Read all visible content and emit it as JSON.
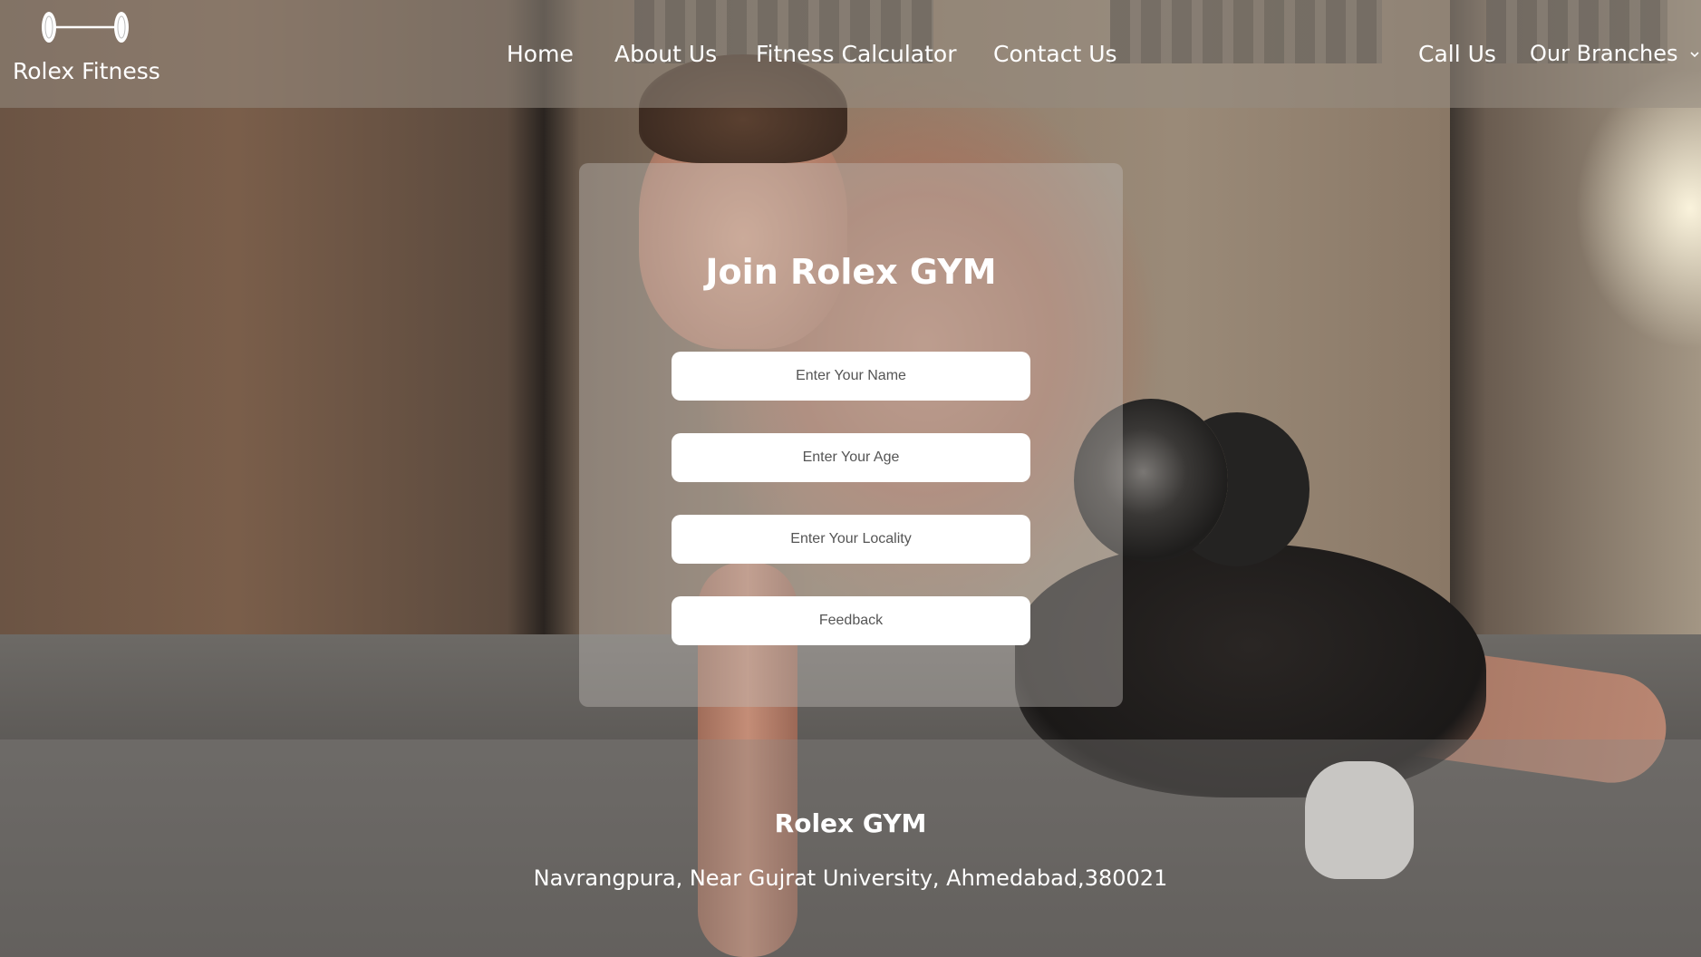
{
  "header": {
    "brand": "Rolex Fitness",
    "logo_icon": "dumbbell-icon",
    "nav": {
      "home": "Home",
      "about": "About Us",
      "calculator": "Fitness Calculator",
      "contact": "Contact Us",
      "call": "Call Us",
      "branches": "Our Branches"
    },
    "branches_icon": "chevron-down-icon"
  },
  "form": {
    "title": "Join Rolex GYM",
    "name_placeholder": "Enter Your Name",
    "age_placeholder": "Enter Your Age",
    "locality_placeholder": "Enter Your Locality",
    "feedback_placeholder": "Feedback"
  },
  "footer": {
    "title": "Rolex GYM",
    "address": "Navrangpura, Near Gujrat University, Ahmedabad,380021"
  }
}
